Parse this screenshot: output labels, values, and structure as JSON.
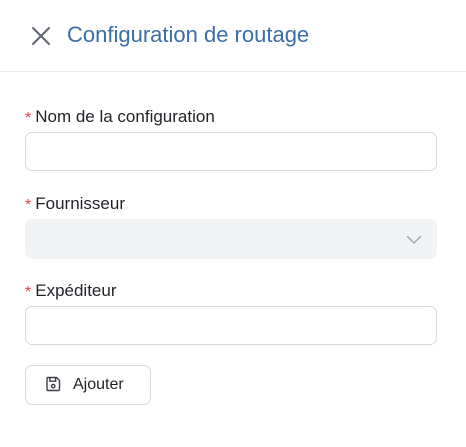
{
  "header": {
    "title": "Configuration de routage",
    "close_icon": "close-icon"
  },
  "form": {
    "required_marker": "*",
    "fields": [
      {
        "label": "Nom de la configuration",
        "value": "",
        "placeholder": "",
        "type": "text",
        "required": true
      },
      {
        "label": "Fournisseur",
        "value": "",
        "placeholder": "",
        "type": "select",
        "required": true,
        "disabled": true,
        "icon": "chevron-down-icon"
      },
      {
        "label": "Expéditeur",
        "value": "",
        "placeholder": "",
        "type": "text",
        "required": true
      }
    ]
  },
  "actions": {
    "add_label": "Ajouter",
    "add_icon": "save-icon"
  },
  "colors": {
    "title": "#3b6ea5",
    "required": "#e0453e",
    "border": "#d6d9de",
    "disabled_bg": "#f2f3f5"
  }
}
